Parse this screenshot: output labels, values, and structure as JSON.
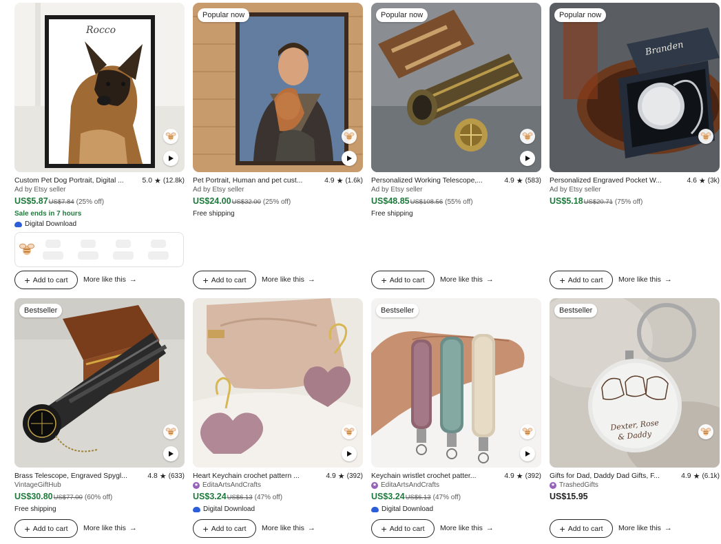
{
  "listings": [
    {
      "badge": "",
      "title": "Custom Pet Dog Portrait, Digital ...",
      "score": "5.0",
      "reviews": "(12.8k)",
      "seller": "Ad by Etsy seller",
      "price": "US$5.87",
      "original_price": "US$7.84",
      "discount": "(25% off)",
      "extra1": "Sale ends in 7 hours",
      "extra2": "Digital Download",
      "cart_label": "Add to cart",
      "more_label": "More like this"
    },
    {
      "badge": "Popular now",
      "title": "Pet Portrait, Human and pet cust...",
      "score": "4.9",
      "reviews": "(1.6k)",
      "seller": "Ad by Etsy seller",
      "price": "US$24.00",
      "original_price": "US$32.00",
      "discount": "(25% off)",
      "extra1": "Free shipping",
      "cart_label": "Add to cart",
      "more_label": "More like this"
    },
    {
      "badge": "Popular now",
      "title": "Personalized Working Telescope,...",
      "score": "4.9",
      "reviews": "(583)",
      "seller": "Ad by Etsy seller",
      "price": "US$48.85",
      "original_price": "US$108.56",
      "discount": "(55% off)",
      "extra1": "Free shipping",
      "cart_label": "Add to cart",
      "more_label": "More like this"
    },
    {
      "badge": "Popular now",
      "title": "Personalized Engraved Pocket W...",
      "score": "4.6",
      "reviews": "(3k)",
      "seller": "Ad by Etsy seller",
      "price": "US$5.18",
      "original_price": "US$20.71",
      "discount": "(75% off)",
      "cart_label": "Add to cart",
      "more_label": "More like this"
    },
    {
      "badge": "Bestseller",
      "title": "Brass Telescope, Engraved Spygl...",
      "score": "4.8",
      "reviews": "(633)",
      "seller": "VintageGiftHub",
      "price": "US$30.80",
      "original_price": "US$77.00",
      "discount": "(60% off)",
      "extra1": "Free shipping",
      "cart_label": "Add to cart",
      "more_label": "More like this"
    },
    {
      "badge": "",
      "title": "Heart Keychain crochet pattern ...",
      "score": "4.9",
      "reviews": "(392)",
      "seller": "EditaArtsAndCrafts",
      "price": "US$3.24",
      "original_price": "US$6.13",
      "discount": "(47% off)",
      "extra2": "Digital Download",
      "cart_label": "Add to cart",
      "more_label": "More like this"
    },
    {
      "badge": "Bestseller",
      "title": "Keychain wristlet crochet patter...",
      "score": "4.9",
      "reviews": "(392)",
      "seller": "EditaArtsAndCrafts",
      "price": "US$3.24",
      "original_price": "US$6.13",
      "discount": "(47% off)",
      "extra2": "Digital Download",
      "cart_label": "Add to cart",
      "more_label": "More like this"
    },
    {
      "badge": "Bestseller",
      "title": "Gifts for Dad, Daddy Dad Gifts, F...",
      "score": "4.9",
      "reviews": "(6.1k)",
      "seller": "TrashedGifts",
      "price": "US$15.95",
      "cart_label": "Add to cart",
      "more_label": "More like this"
    }
  ],
  "image_text": {
    "portrait_name": "Rocco",
    "box_name": "Branden",
    "tag_line1": "Dexter, Rose",
    "tag_line2": "& Daddy"
  },
  "colors": {
    "sale_price": "#1d7a3b",
    "download_icon": "#2b5ed8",
    "star_seller": "#9560b8"
  },
  "icons": {
    "favorite": "bee-favorite-icon",
    "play": "play-icon",
    "rating": "star-icon",
    "download": "cloud-download-icon",
    "add": "plus-icon",
    "more": "arrow-right-icon"
  }
}
